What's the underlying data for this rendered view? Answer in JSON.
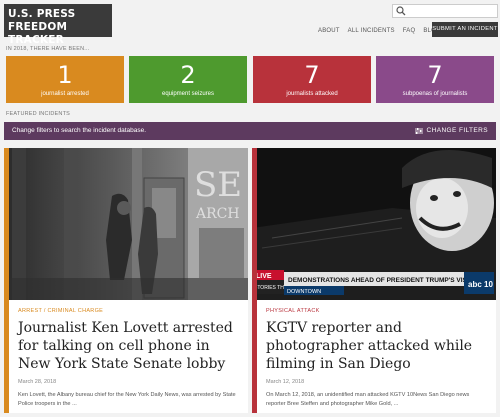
{
  "header": {
    "logo_line1": "U.S. PRESS",
    "logo_line2": "FREEDOM TRACKER",
    "search_placeholder": "",
    "nav": [
      "ABOUT",
      "ALL INCIDENTS",
      "FAQ",
      "BLOG"
    ],
    "submit_label": "SUBMIT AN INCIDENT"
  },
  "summary": {
    "intro": "IN 2018, THERE HAVE BEEN...",
    "stats": [
      {
        "value": "1",
        "label": "journalist arrested",
        "color": "#d98a1f"
      },
      {
        "value": "2",
        "label": "equipment seizures",
        "color": "#4e9a2e"
      },
      {
        "value": "7",
        "label": "journalists attacked",
        "color": "#b8323b"
      },
      {
        "value": "7",
        "label": "subpoenas of journalists",
        "color": "#8a4a8a"
      }
    ]
  },
  "featured": {
    "label": "FEATURED INCIDENTS",
    "filter_text": "Change filters to search the incident database.",
    "filter_button": "CHANGE FILTERS"
  },
  "cards": [
    {
      "category": "ARREST / CRIMINAL CHARGE",
      "title": "Journalist Ken Lovett arrested for talking on cell phone in New York State Senate lobby",
      "date": "March 28, 2018",
      "excerpt": "Ken Lovett, the Albany bureau chief for the New York Daily News, was arrested by State Police troopers in the ...",
      "accent": "#d98a1f",
      "image_text": [
        "SE",
        "ARCH"
      ]
    },
    {
      "category": "PHYSICAL ATTACK",
      "title": "KGTV reporter and photographer attacked while filming in San Diego",
      "date": "March 12, 2018",
      "excerpt": "On March 12, 2018, an unidentified man attacked KGTV 10News San Diego news reporter Bree Steffen and photographer Mike Gold, ...",
      "accent": "#b8323b",
      "image_text": {
        "live": "LIVE",
        "tag": "STORIES THAT MATTER",
        "headline": "DEMONSTRATIONS AHEAD OF PRESIDENT TRUMP'S VISIT",
        "sub": "DOWNTOWN",
        "channel": "abc 10"
      }
    }
  ]
}
